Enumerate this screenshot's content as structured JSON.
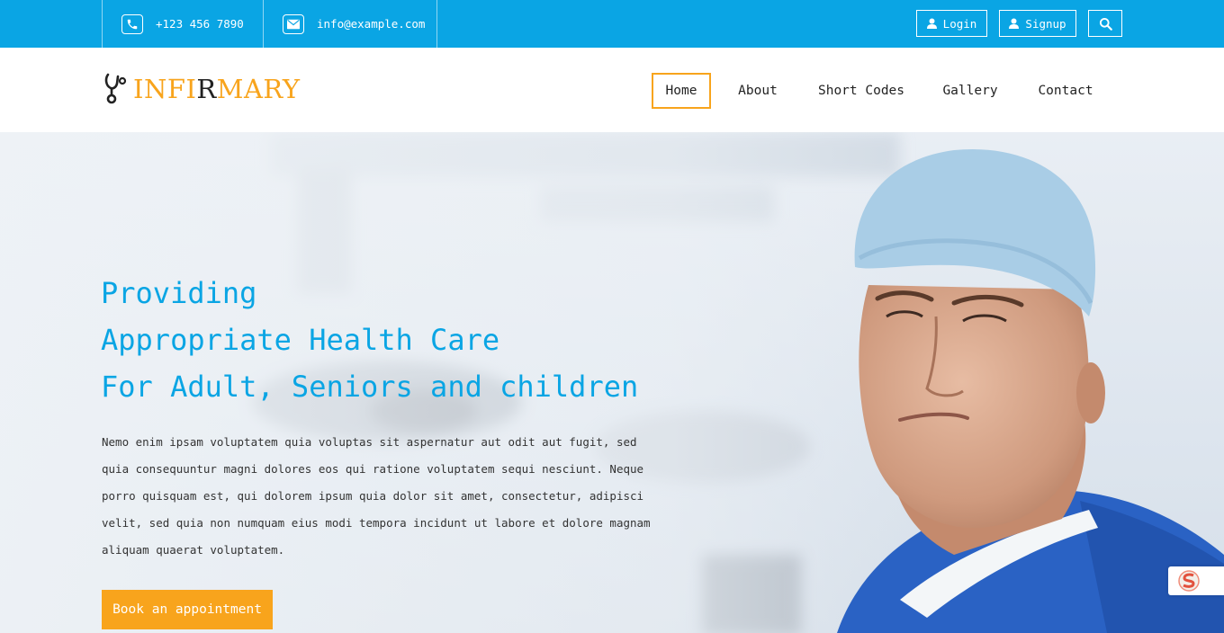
{
  "topbar": {
    "phone": "+123 456 7890",
    "email": "info@example.com",
    "login_label": "Login",
    "signup_label": "Signup",
    "icons": {
      "phone": "phone-icon",
      "email": "envelope-icon",
      "login": "user-icon",
      "signup": "user-icon",
      "search": "search-icon"
    }
  },
  "header": {
    "logo": {
      "part1": "INFI",
      "part2": "R",
      "part3": "MARY",
      "icon": "stethoscope-icon"
    },
    "nav": [
      {
        "label": "Home",
        "active": true
      },
      {
        "label": "About"
      },
      {
        "label": "Short Codes"
      },
      {
        "label": "Gallery"
      },
      {
        "label": "Contact"
      }
    ]
  },
  "hero": {
    "heading_lines": [
      "Providing",
      "Appropriate Health Care",
      "For Adult, Seniors and children"
    ],
    "description": "Nemo enim ipsam voluptatem quia voluptas sit aspernatur aut odit aut fugit, sed quia consequuntur magni dolores eos qui ratione voluptatem sequi nesciunt. Neque porro quisquam est, qui dolorem ipsum quia dolor sit amet, consectetur, adipisci velit, sed quia non numquam eius modi tempora incidunt ut labore et dolore magnam aliquam quaerat voluptatem.",
    "cta_label": "Book an appointment"
  },
  "colors": {
    "primary": "#0aa5e4",
    "accent": "#f8a41c",
    "scrubs": "#2a62c4",
    "text": "#333333"
  }
}
